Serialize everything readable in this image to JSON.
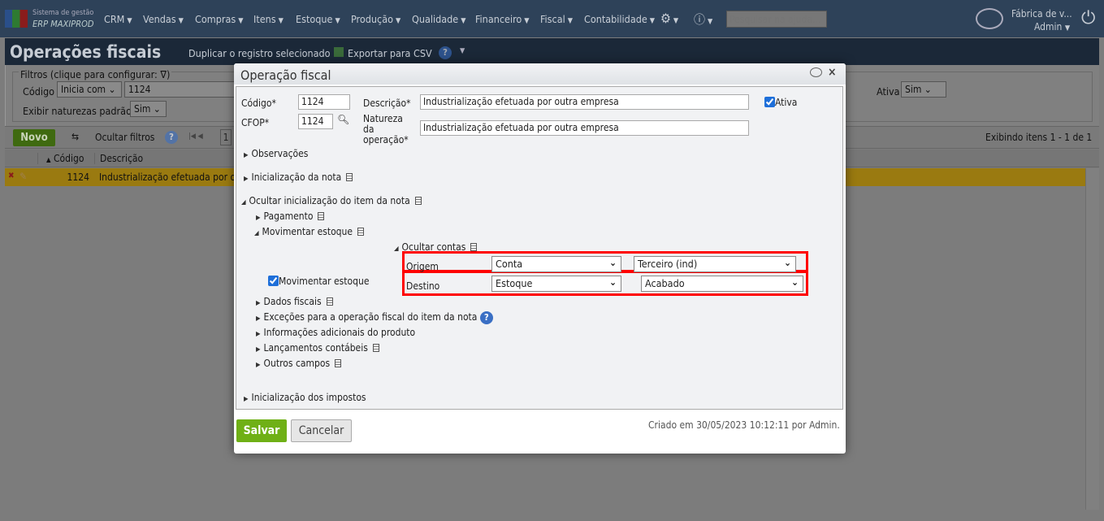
{
  "app": {
    "logo_line1": "Sistema de gestão",
    "logo_line2": "ERP MAXIPROD"
  },
  "nav": {
    "menus": [
      "CRM",
      "Vendas",
      "Compras",
      "Itens",
      "Estoque",
      "Produção",
      "Qualidade",
      "Financeiro",
      "Fiscal",
      "Contabilidade"
    ],
    "search_placeholder": "Pesquisar na ajuda...",
    "company": "Fábrica de v...",
    "user": "Admin"
  },
  "page": {
    "title": "Operações fiscais",
    "duplicate": "Duplicar o registro selecionado",
    "export": "Exportar para CSV"
  },
  "filters": {
    "legend": "Filtros (clique para configurar:",
    "legend_end": ")",
    "codigo_label": "Código",
    "codigo_op": "Inicia com",
    "codigo_value": "1124",
    "exibir_label": "Exibir naturezas padrão",
    "exibir_value": "Sim",
    "ativa_label": "Ativa",
    "ativa_value": "Sim"
  },
  "toolbar": {
    "novo": "Novo",
    "hide_filters": "Ocultar filtros",
    "page": "1",
    "showing": "Exibindo itens 1 - 1 de 1"
  },
  "grid": {
    "columns": [
      "Código",
      "Descrição"
    ],
    "rows": [
      {
        "codigo": "1124",
        "descricao": "Industrialização efetuada por o"
      }
    ]
  },
  "dialog": {
    "title": "Operação fiscal",
    "codigo_label": "Código*",
    "codigo": "1124",
    "cfop_label": "CFOP*",
    "cfop": "1124",
    "descricao_label": "Descrição*",
    "descricao": "Industrialização efetuada por outra empresa",
    "natureza_label1": "Natureza",
    "natureza_label2": "da",
    "natureza_label3": "operação*",
    "natureza": "Industrialização efetuada por outra empresa",
    "ativa_label": "Ativa",
    "sections": {
      "observacoes": "Observações",
      "inic_nota": "Inicialização da nota",
      "ocultar_item": "Ocultar inicialização do item da nota",
      "pagamento": "Pagamento",
      "movimentar": "Movimentar estoque",
      "ocultar_contas": "Ocultar contas",
      "dados_fiscais": "Dados fiscais",
      "excecoes": "Exceções para a operação fiscal do item da nota",
      "info_adic": "Informações adicionais do produto",
      "lancamentos": "Lançamentos contábeis",
      "outros": "Outros campos",
      "impostos": "Inicialização dos impostos"
    },
    "mov_checkbox": "Movimentar estoque",
    "origem_label": "Origem",
    "origem_tipo": "Conta",
    "origem_valor": "Terceiro (ind)",
    "destino_label": "Destino",
    "destino_tipo": "Estoque",
    "destino_valor": "Acabado",
    "save": "Salvar",
    "cancel": "Cancelar",
    "created": "Criado em 30/05/2023 10:12:11 por Admin."
  }
}
